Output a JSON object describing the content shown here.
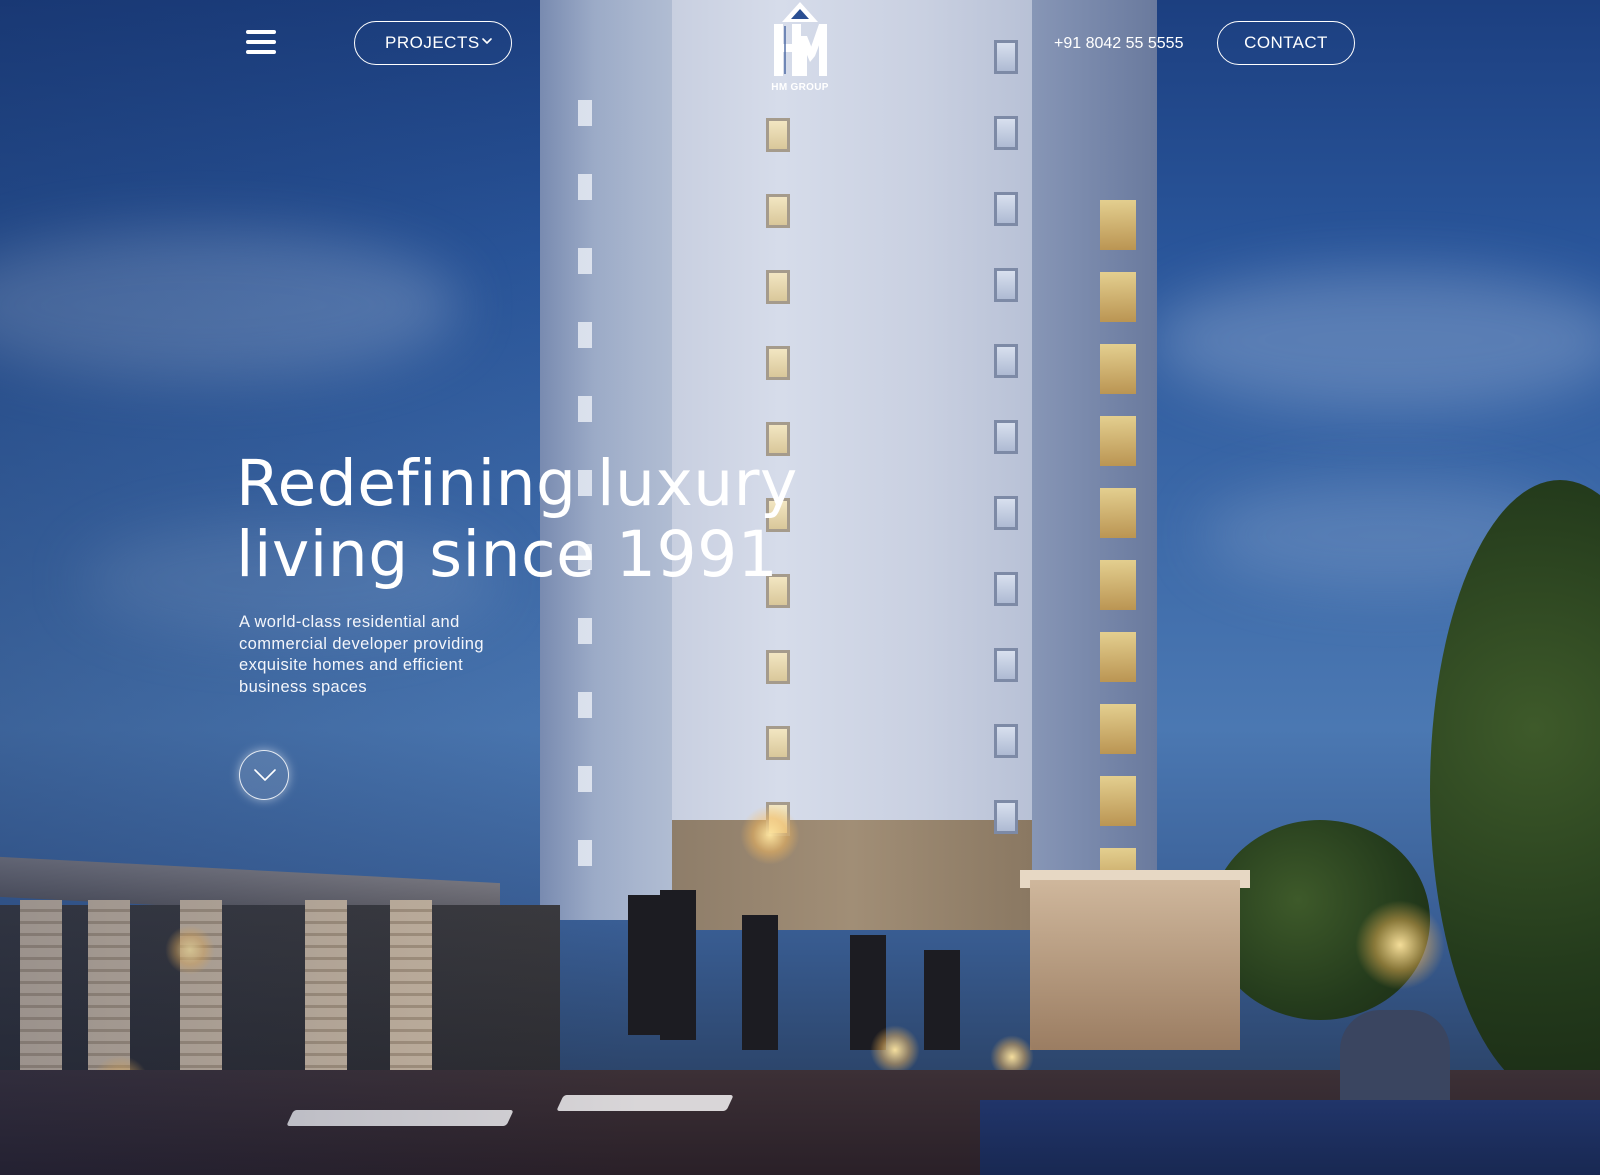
{
  "header": {
    "projects_label": "PROJECTS",
    "logo_text": "HM GROUP",
    "phone": "+91 8042 55 5555",
    "contact_label": "CONTACT"
  },
  "hero": {
    "title_line1": "Redefining luxury",
    "title_line2": "living since 1991",
    "subtitle": "A world-class residential and commercial developer providing exquisite homes and efficient business spaces"
  },
  "icons": {
    "menu": "hamburger-menu-icon",
    "projects_dropdown": "chevron-down-icon",
    "scroll": "chevron-down-icon"
  },
  "colors": {
    "text": "#ffffff",
    "sky_top": "#1c3f80",
    "sky_mid": "#4b78b2"
  }
}
